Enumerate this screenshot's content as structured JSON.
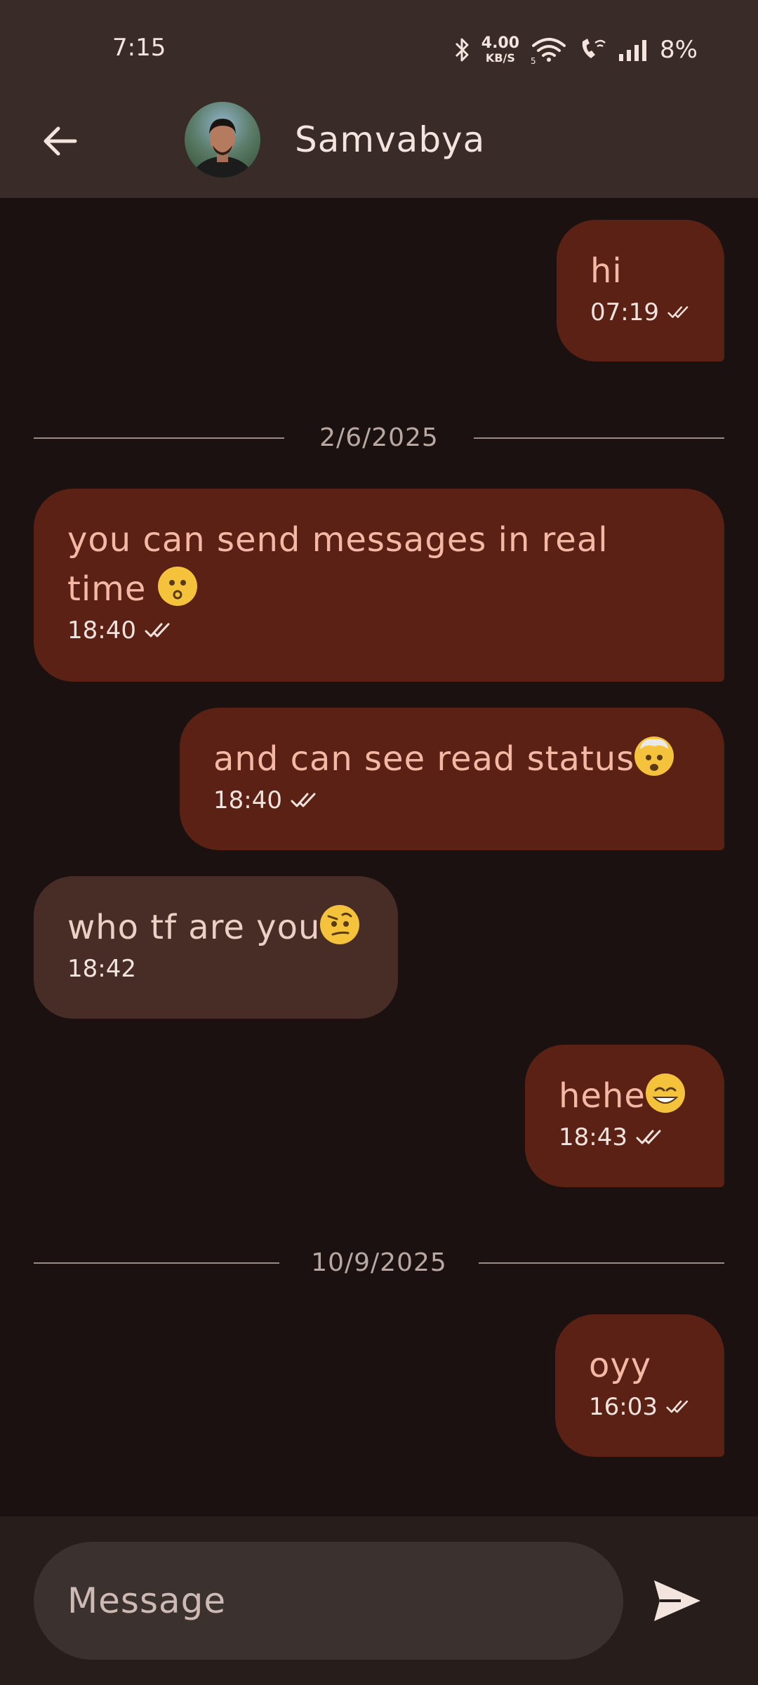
{
  "status_bar": {
    "time": "7:15",
    "net_speed_value": "4.00",
    "net_speed_unit": "KB/S",
    "battery": "8%",
    "icons": [
      "bluetooth-icon",
      "wifi-icon",
      "wifi-call-icon",
      "signal-icon"
    ]
  },
  "header": {
    "contact_name": "Samvabya",
    "back_icon": "arrow-left-icon"
  },
  "messages": [
    {
      "text": "hi",
      "time": "07:19",
      "direction": "out",
      "read": true
    },
    {
      "separator": "2/6/2025"
    },
    {
      "text": "you can send messages in real time",
      "emoji": "kissing-face",
      "time": "18:40",
      "direction": "out",
      "read": true
    },
    {
      "text": "and can see read status",
      "emoji": "exploding-head",
      "time": "18:40",
      "direction": "out",
      "read": true
    },
    {
      "text": "who tf are you",
      "emoji": "raised-eyebrow-face",
      "time": "18:42",
      "direction": "in"
    },
    {
      "text": "hehe",
      "emoji": "grinning-face",
      "time": "18:43",
      "direction": "out",
      "read": true
    },
    {
      "separator": "10/9/2025"
    },
    {
      "text": "oyy",
      "time": "16:03",
      "direction": "out",
      "read": true
    }
  ],
  "composer": {
    "placeholder": "Message",
    "send_icon": "send-icon"
  },
  "colors": {
    "app_bar": "#382b28",
    "background": "#1a1110",
    "outgoing_bubble": "#5a2114",
    "incoming_bubble": "#482d27",
    "outgoing_text": "#f4b8a4"
  }
}
